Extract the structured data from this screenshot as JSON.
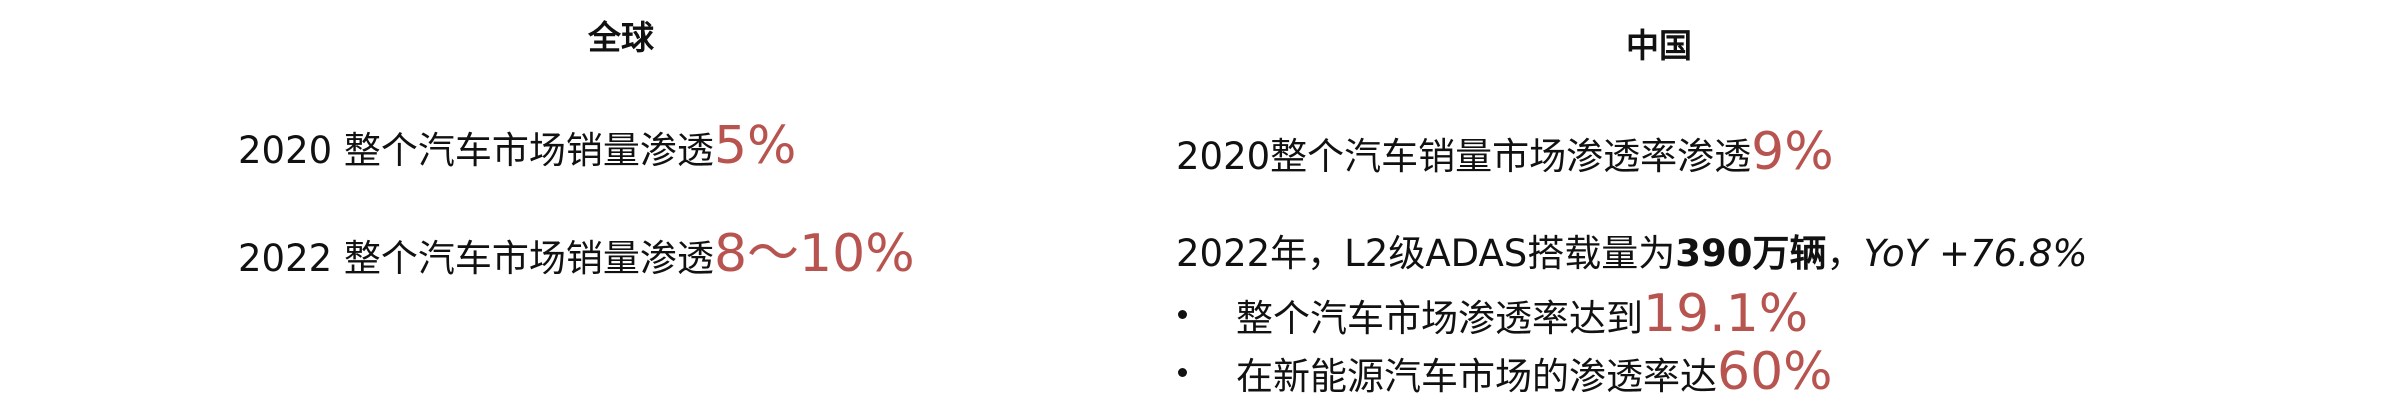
{
  "global": {
    "heading": "全球",
    "line1": {
      "prefix": "2020 整个汽车市场销量渗透",
      "value": "5%"
    },
    "line2": {
      "prefix": "2022 整个汽车市场销量渗透",
      "value": "8～10%"
    }
  },
  "china": {
    "heading": "中国",
    "line1": {
      "prefix": "2020整个汽车销量市场渗透率渗透",
      "value": "9%"
    },
    "line2": {
      "prefix": "2022年，L2级ADAS搭载量为",
      "bold": "390万辆",
      "sep": "，",
      "yoy": "YoY +76.8%"
    },
    "bullets": [
      {
        "prefix": "整个汽车市场渗透率达到",
        "value": "19.1%"
      },
      {
        "prefix": "在新能源汽车市场的渗透率达",
        "value": "60%"
      }
    ]
  },
  "colors": {
    "highlight": "#b85450",
    "text": "#111111"
  }
}
